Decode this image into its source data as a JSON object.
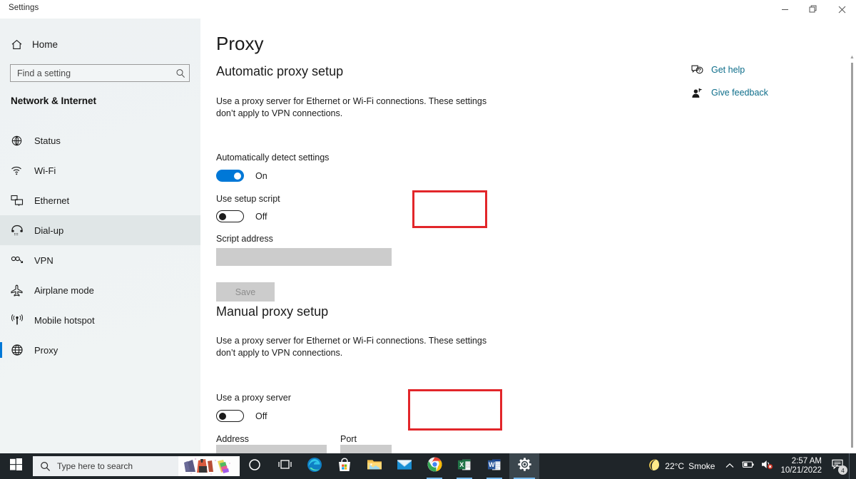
{
  "window": {
    "caption": "Settings",
    "controls": [
      {
        "name": "minimize",
        "label": "Minimize"
      },
      {
        "name": "maximize",
        "label": "Restore"
      },
      {
        "name": "close",
        "label": "Close"
      }
    ]
  },
  "sidebar": {
    "home_label": "Home",
    "home_icon": "home-icon",
    "search": {
      "placeholder": "Find a setting",
      "value": "",
      "icon": "search-icon"
    },
    "category_title": "Network & Internet",
    "items": [
      {
        "label": "Status",
        "icon": "globe-status-icon",
        "state": "normal"
      },
      {
        "label": "Wi-Fi",
        "icon": "wifi-icon",
        "state": "normal"
      },
      {
        "label": "Ethernet",
        "icon": "ethernet-icon",
        "state": "normal"
      },
      {
        "label": "Dial-up",
        "icon": "dialup-icon",
        "state": "hovered"
      },
      {
        "label": "VPN",
        "icon": "vpn-icon",
        "state": "normal"
      },
      {
        "label": "Airplane mode",
        "icon": "airplane-icon",
        "state": "normal"
      },
      {
        "label": "Mobile hotspot",
        "icon": "hotspot-icon",
        "state": "normal"
      },
      {
        "label": "Proxy",
        "icon": "globe-proxy-icon",
        "state": "selected"
      }
    ]
  },
  "main": {
    "page_title": "Proxy",
    "automatic": {
      "heading": "Automatic proxy setup",
      "description": "Use a proxy server for Ethernet or Wi-Fi connections. These settings don’t apply to VPN connections.",
      "auto_detect_label": "Automatically detect settings",
      "auto_detect_state": "On",
      "setup_script_label": "Use setup script",
      "setup_script_state": "Off",
      "script_address_label": "Script address",
      "script_address_value": "",
      "save_label": "Save"
    },
    "manual": {
      "heading": "Manual proxy setup",
      "description": "Use a proxy server for Ethernet or Wi-Fi connections. These settings don’t apply to VPN connections.",
      "use_proxy_label": "Use a proxy server",
      "use_proxy_state": "Off",
      "address_label": "Address",
      "address_value": "",
      "port_label": "Port",
      "port_value": ""
    }
  },
  "help_panel": {
    "items": [
      {
        "label": "Get help",
        "icon": "help-bubble-icon"
      },
      {
        "label": "Give feedback",
        "icon": "feedback-person-icon"
      }
    ]
  },
  "annotations": {
    "color": "#e2262a",
    "boxes": [
      {
        "target": "Use setup script"
      },
      {
        "target": "Use a proxy server"
      }
    ]
  },
  "taskbar": {
    "start_icon": "windows-start-icon",
    "search": {
      "placeholder": "Type here to search",
      "value": "",
      "icon": "search-icon"
    },
    "buttons": [
      {
        "name": "cortana",
        "icon": "cortana-circle-icon",
        "state": "normal"
      },
      {
        "name": "task-view",
        "icon": "task-view-icon",
        "state": "normal"
      },
      {
        "name": "edge",
        "icon": "edge-icon",
        "state": "normal"
      },
      {
        "name": "store",
        "icon": "microsoft-store-icon",
        "state": "normal"
      },
      {
        "name": "explorer",
        "icon": "file-explorer-icon",
        "state": "normal"
      },
      {
        "name": "mail",
        "icon": "mail-icon",
        "state": "normal"
      },
      {
        "name": "chrome",
        "icon": "chrome-icon",
        "state": "running"
      },
      {
        "name": "excel",
        "icon": "excel-icon",
        "state": "running"
      },
      {
        "name": "word",
        "icon": "word-icon",
        "state": "running"
      },
      {
        "name": "settings",
        "icon": "gear-icon",
        "state": "active"
      }
    ],
    "tray": {
      "weather_icon": "moon-icon",
      "temperature": "22°C",
      "condition": "Smoke",
      "chevron_icon": "chevron-up-icon",
      "battery_icon": "battery-icon",
      "volume_icon": "volume-muted-icon",
      "time": "2:57 AM",
      "date": "10/21/2022",
      "notifications_icon": "notification-icon",
      "notifications_count": "4"
    }
  }
}
